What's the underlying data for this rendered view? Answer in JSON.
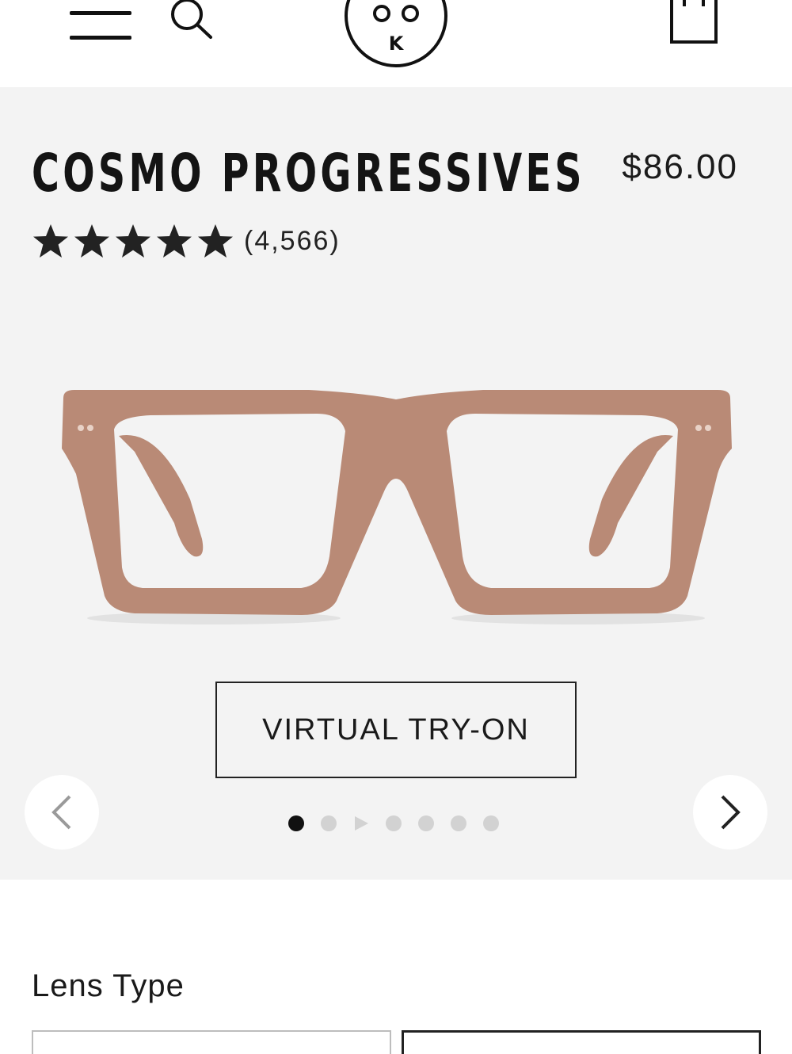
{
  "header": {
    "menu_icon": "hamburger-menu-icon",
    "search_icon": "search-icon",
    "logo_text": "K",
    "bag_icon": "shopping-bag-icon"
  },
  "product": {
    "title": "COSMO PROGRESSIVES",
    "price": "$86.00",
    "rating": 5,
    "rating_max": 5,
    "review_count": "(4,566)",
    "frame_color": "#b98a76"
  },
  "gallery": {
    "try_on_label": "VIRTUAL TRY-ON",
    "prev_icon": "chevron-left-icon",
    "next_icon": "chevron-right-icon",
    "slide_count": 7,
    "active_slide": 1
  },
  "lens": {
    "section_title": "Lens Type"
  },
  "colors": {
    "hero_background": "#f3f3f3",
    "text": "#111111"
  }
}
